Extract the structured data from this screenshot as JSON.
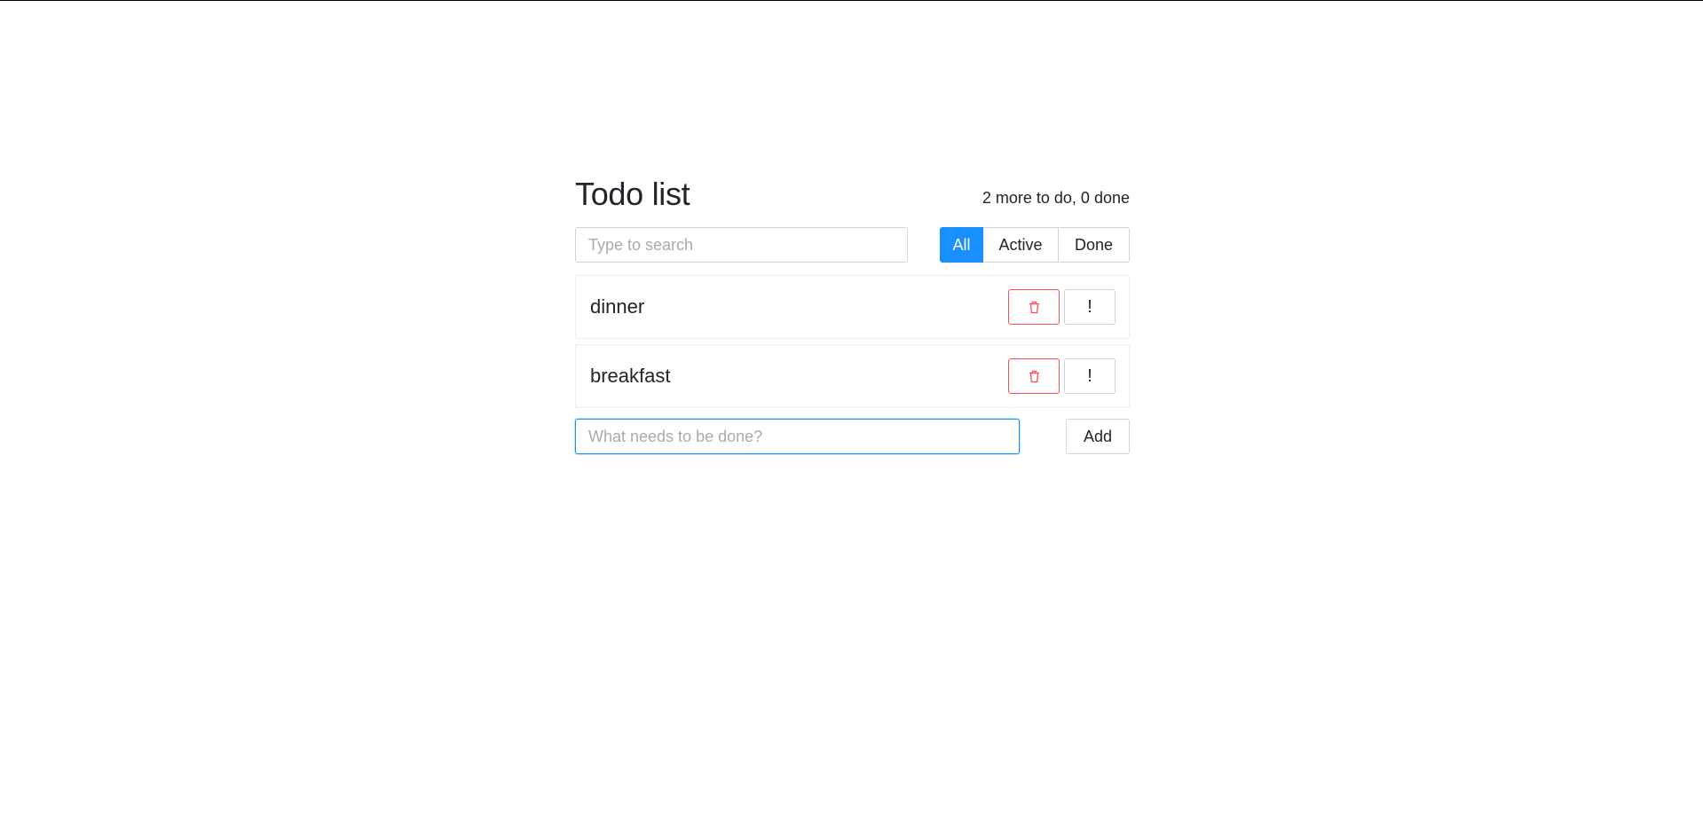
{
  "header": {
    "title": "Todo list",
    "counter": "2 more to do, 0 done"
  },
  "search": {
    "placeholder": "Type to search",
    "value": ""
  },
  "filters": [
    {
      "label": "All",
      "active": true
    },
    {
      "label": "Active",
      "active": false
    },
    {
      "label": "Done",
      "active": false
    }
  ],
  "todos": [
    {
      "label": "dinner",
      "delete_icon": "trash-icon",
      "important_label": "!"
    },
    {
      "label": "breakfast",
      "delete_icon": "trash-icon",
      "important_label": "!"
    }
  ],
  "new_item": {
    "placeholder": "What needs to be done?",
    "value": "",
    "add_label": "Add"
  },
  "colors": {
    "accent": "#1890ff",
    "danger": "#ff4d55",
    "border": "#ced4da",
    "text": "#212529"
  }
}
